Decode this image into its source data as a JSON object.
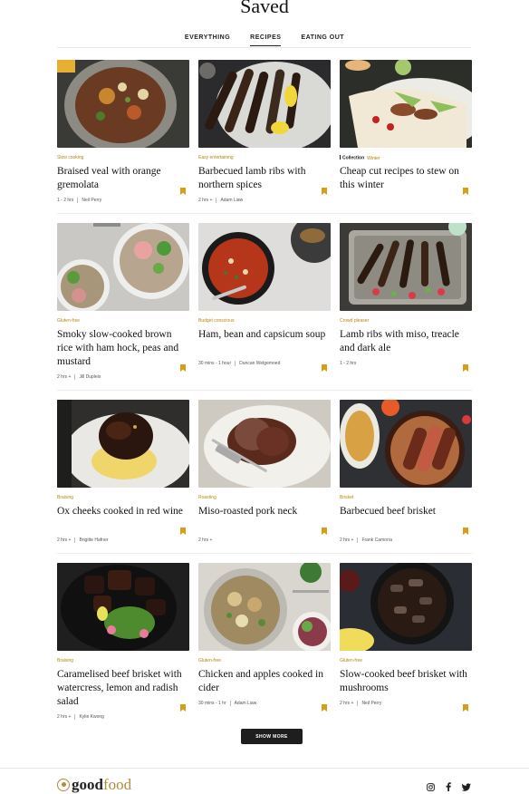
{
  "header": {
    "title": "Saved",
    "tabs": [
      {
        "label": "EVERYTHING",
        "active": false
      },
      {
        "label": "RECIPES",
        "active": true
      },
      {
        "label": "EATING OUT",
        "active": false
      }
    ]
  },
  "cards": [
    {
      "tag": "Slow cooking",
      "title": "Braised veal with orange gremolata",
      "time": "1 - 2 hrs",
      "author": "Neil Perry"
    },
    {
      "tag": "Easy entertaining",
      "title": "Barbecued lamb ribs with northern spices",
      "time": "2 hrs +",
      "author": "Adam Liaw"
    },
    {
      "tag_collection": "Collection",
      "tag": "Winter",
      "title": "Cheap cut recipes to stew on this winter",
      "time": "",
      "author": ""
    },
    {
      "tag": "Gluten-free",
      "title": "Smoky slow-cooked brown rice with ham hock, peas and mustard",
      "time": "2 hrs +",
      "author": "Jill Dupleix"
    },
    {
      "tag": "Budget conscious",
      "title": "Ham, bean and capsicum soup",
      "time": "30 mins - 1 hour",
      "author": "Duncan Welgemoed"
    },
    {
      "tag": "Crowd pleaser",
      "title": "Lamb ribs with miso, treacle and dark ale",
      "time": "1 - 2 hrs",
      "author": ""
    },
    {
      "tag": "Braising",
      "title": "Ox cheeks cooked in red wine",
      "time": "2 hrs +",
      "author": "Brigitte Hafner"
    },
    {
      "tag": "Roasting",
      "title": "Miso-roasted pork neck",
      "time": "2 hrs +",
      "author": ""
    },
    {
      "tag": "Brisket",
      "title": "Barbecued beef brisket",
      "time": "2 hrs +",
      "author": "Frank Camorra"
    },
    {
      "tag": "Braising",
      "title": "Caramelised beef brisket with watercress, lemon and radish salad",
      "time": "2 hrs +",
      "author": "Kylie Kwong"
    },
    {
      "tag": "Gluten-free",
      "title": "Chicken and apples cooked in cider",
      "time": "30 mins - 1 hr",
      "author": "Adam Liaw"
    },
    {
      "tag": "Gluten-free",
      "title": "Slow-cooked beef brisket with mushrooms",
      "time": "2 hrs +",
      "author": "Neil Perry"
    }
  ],
  "show_more_label": "SHOW MORE",
  "footer": {
    "logo_good": "good",
    "logo_food": "food",
    "social_icons": [
      "instagram-icon",
      "facebook-icon",
      "twitter-icon"
    ]
  },
  "colors": {
    "accent": "#d4a017",
    "tag": "#b8860b",
    "button": "#1e1e1e"
  }
}
